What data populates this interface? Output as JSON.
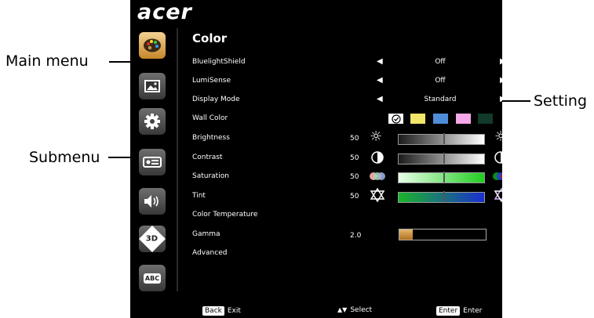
{
  "callouts": {
    "main_menu": "Main menu",
    "submenu": "Submenu",
    "setting": "Setting"
  },
  "logo": "acer",
  "menu": {
    "title": "Color",
    "icon_3d": "3D",
    "icon_abc": "ABC"
  },
  "items": {
    "bluelight_shield": {
      "label": "BluelightShield",
      "value": "Off"
    },
    "lumisense": {
      "label": "LumiSense",
      "value": "Off"
    },
    "display_mode": {
      "label": "Display Mode",
      "value": "Standard"
    },
    "wall_color": {
      "label": "Wall Color",
      "swatches": [
        "#ffffff",
        "#f4e66a",
        "#4f8ddb",
        "#f5a8e8",
        "#123a2a"
      ]
    },
    "brightness": {
      "label": "Brightness",
      "value": "50",
      "level": 0.5
    },
    "contrast": {
      "label": "Contrast",
      "value": "50",
      "level": 0.5
    },
    "saturation": {
      "label": "Saturation",
      "value": "50",
      "level": 0.5
    },
    "tint": {
      "label": "Tint",
      "value": "50",
      "level": 0.5
    },
    "color_temperature": {
      "label": "Color Temperature"
    },
    "gamma": {
      "label": "Gamma",
      "value": "2.0",
      "level": 0.15
    },
    "advanced": {
      "label": "Advanced"
    }
  },
  "footer": {
    "back_key": "Back",
    "back_label": "Exit",
    "select_label": "Select",
    "enter_key": "Enter",
    "enter_label": "Enter"
  }
}
